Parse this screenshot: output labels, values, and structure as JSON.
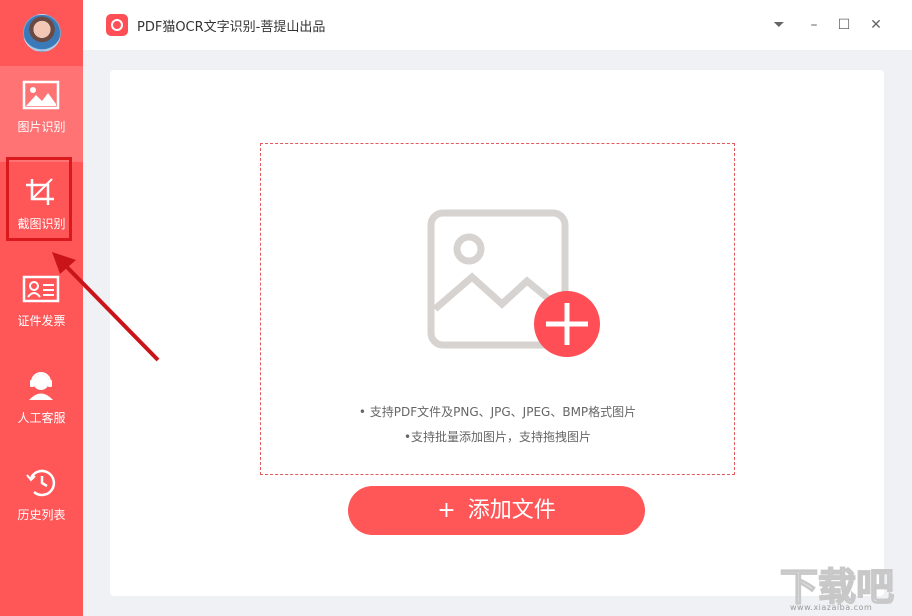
{
  "app": {
    "title": "PDF猫OCR文字识别-菩提山出品"
  },
  "sidebar": {
    "items": [
      {
        "label": "图片识别",
        "icon": "image-icon"
      },
      {
        "label": "截图识别",
        "icon": "crop-icon"
      },
      {
        "label": "证件发票",
        "icon": "id-card-icon"
      },
      {
        "label": "人工客服",
        "icon": "customer-service-icon"
      },
      {
        "label": "历史列表",
        "icon": "history-icon"
      }
    ]
  },
  "window_controls": {
    "menu": "⏷",
    "minimize": "–",
    "maximize": "☐",
    "close": "✕"
  },
  "dropzone": {
    "hint1": "• 支持PDF文件及PNG、JPG、JPEG、BMP格式图片",
    "hint2": "•支持批量添加图片，支持拖拽图片"
  },
  "add_button": {
    "plus": "+",
    "label": "添加文件"
  },
  "colors": {
    "accent": "#ff5658",
    "sidebar_active": "#ff7375",
    "annotation": "#d9191c"
  },
  "watermark": {
    "text": "www.xiazaiba.com"
  }
}
